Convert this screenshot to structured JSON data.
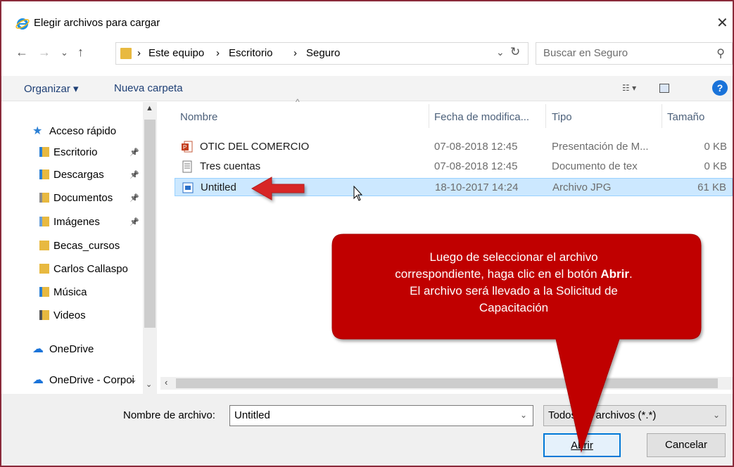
{
  "window": {
    "title": "Elegir archivos para cargar",
    "close_glyph": "✕"
  },
  "address": {
    "crumbs": [
      "Este equipo",
      "Escritorio",
      "Seguro"
    ],
    "separator": "›",
    "search_placeholder": "Buscar en Seguro"
  },
  "toolbar": {
    "organize_label": "Organizar ▾",
    "new_folder_label": "Nueva carpeta",
    "help_label": "?"
  },
  "nav": {
    "items": [
      {
        "label": "Acceso rápido",
        "icon": "star-icon",
        "pinned": false
      },
      {
        "label": "Escritorio",
        "icon": "desktop-folder-icon",
        "pinned": true
      },
      {
        "label": "Descargas",
        "icon": "downloads-folder-icon",
        "pinned": true
      },
      {
        "label": "Documentos",
        "icon": "documents-folder-icon",
        "pinned": true
      },
      {
        "label": "Imágenes",
        "icon": "pictures-folder-icon",
        "pinned": true
      },
      {
        "label": "Becas_cursos",
        "icon": "folder-icon",
        "pinned": false
      },
      {
        "label": "Carlos Callaspo",
        "icon": "folder-icon",
        "pinned": false
      },
      {
        "label": "Música",
        "icon": "music-folder-icon",
        "pinned": false
      },
      {
        "label": "Videos",
        "icon": "videos-folder-icon",
        "pinned": false
      },
      {
        "label": "OneDrive",
        "icon": "onedrive-icon",
        "pinned": false
      },
      {
        "label": "OneDrive - Corpoi",
        "icon": "onedrive-icon",
        "pinned": false
      }
    ]
  },
  "columns": {
    "name": "Nombre",
    "date": "Fecha de modifica...",
    "type": "Tipo",
    "size": "Tamaño"
  },
  "files": [
    {
      "name": "OTIC DEL COMERCIO",
      "date": "07-08-2018 12:45",
      "type": "Presentación de M...",
      "size": "0 KB",
      "icon": "powerpoint-icon",
      "selected": false
    },
    {
      "name": "Tres cuentas",
      "date": "07-08-2018 12:45",
      "type": "Documento de tex",
      "size": "0 KB",
      "icon": "text-document-icon",
      "selected": false
    },
    {
      "name": "Untitled",
      "date": "18-10-2017 14:24",
      "type": "Archivo JPG",
      "size": "61 KB",
      "icon": "image-file-icon",
      "selected": true
    }
  ],
  "bottom": {
    "filename_label": "Nombre de archivo:",
    "filename_value": "Untitled",
    "filetype_value": "Todos los archivos (*.*)",
    "open_label": "Abrir",
    "cancel_label": "Cancelar"
  },
  "callout": {
    "line1": "Luego de seleccionar el archivo",
    "line2_pre": "correspondiente, haga clic en el botón ",
    "line2_bold": "Abrir",
    "line2_post": ".",
    "line3": "El archivo será llevado a la Solicitud de",
    "line4": "Capacitación",
    "color": "#c00000"
  }
}
